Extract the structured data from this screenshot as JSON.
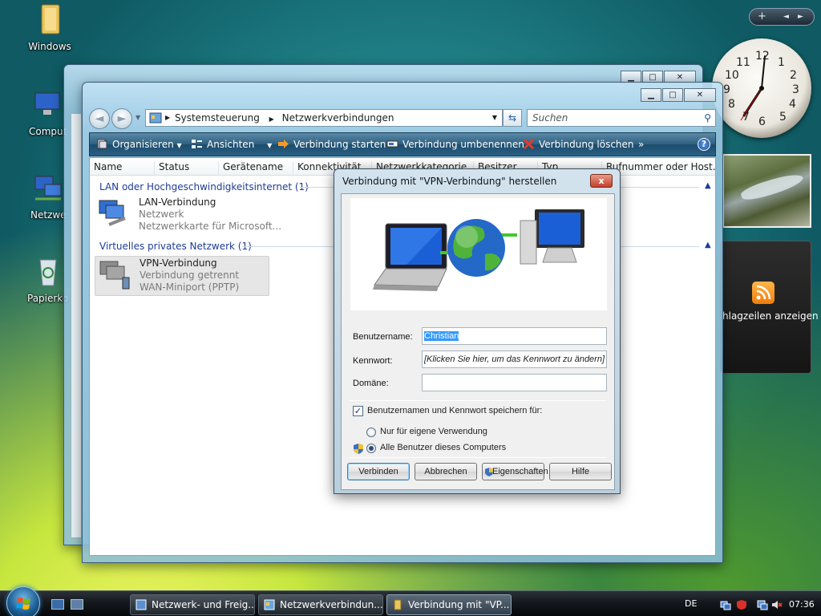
{
  "desktop": {
    "icons": [
      {
        "label": "Windows"
      },
      {
        "label": "Comput"
      },
      {
        "label": "Netzwe"
      },
      {
        "label": "Papierko"
      }
    ]
  },
  "sidebar": {
    "ctrl_add": "+",
    "ctrl_prev": "◄",
    "ctrl_next": "►",
    "rss_label": "hlagzeilen anzeigen"
  },
  "explorer": {
    "breadcrumb": [
      "Systemsteuerung",
      "Netzwerkverbindungen"
    ],
    "search_placeholder": "Suchen",
    "toolbar": [
      {
        "label": "Organisieren",
        "dropdown": true
      },
      {
        "label": "Ansichten",
        "dropdown": true
      },
      {
        "label": "Verbindung starten"
      },
      {
        "label": "Verbindung umbenennen"
      },
      {
        "label": "Verbindung löschen"
      },
      {
        "label": "»"
      }
    ],
    "columns": [
      "Name",
      "Status",
      "Gerätename",
      "Konnektivität",
      "Netzwerkkategorie",
      "Besitzer",
      "Typ",
      "Rufnummer oder Host..."
    ],
    "groups": [
      {
        "title": "LAN oder Hochgeschwindigkeitsinternet (1)",
        "items": [
          {
            "name": "LAN-Verbindung",
            "status": "Netzwerk",
            "device": "Netzwerkkarte für Microsoft..."
          }
        ]
      },
      {
        "title": "Virtuelles privates Netzwerk (1)",
        "items": [
          {
            "name": "VPN-Verbindung",
            "status": "Verbindung getrennt",
            "device": "WAN-Miniport (PPTP)"
          }
        ]
      }
    ]
  },
  "dialog": {
    "title": "Verbindung mit \"VPN-Verbindung\" herstellen",
    "close": "x",
    "username_label": "Benutzername:",
    "username_value": "Christian",
    "password_label": "Kennwort:",
    "password_hint": "[Klicken Sie hier, um das Kennwort zu ändern]",
    "domain_label": "Domäne:",
    "domain_value": "",
    "save_checkbox_label": "Benutzernamen und Kennwort speichern für:",
    "save_checked": true,
    "radio_own": "Nur für eigene Verwendung",
    "radio_all": "Alle Benutzer dieses Computers",
    "radio_selected": "all",
    "buttons": {
      "connect": "Verbinden",
      "cancel": "Abbrechen",
      "properties": "Eigenschaften",
      "help": "Hilfe"
    }
  },
  "taskbar": {
    "tasks": [
      {
        "label": "Netzwerk- und Freig..."
      },
      {
        "label": "Netzwerkverbindun..."
      },
      {
        "label": "Verbindung mit \"VP..."
      }
    ],
    "language": "DE",
    "time": "07:36"
  },
  "colors": {
    "accent": "#2e5f7f",
    "group_text": "#1e3c96",
    "selection": "#3399ff"
  }
}
